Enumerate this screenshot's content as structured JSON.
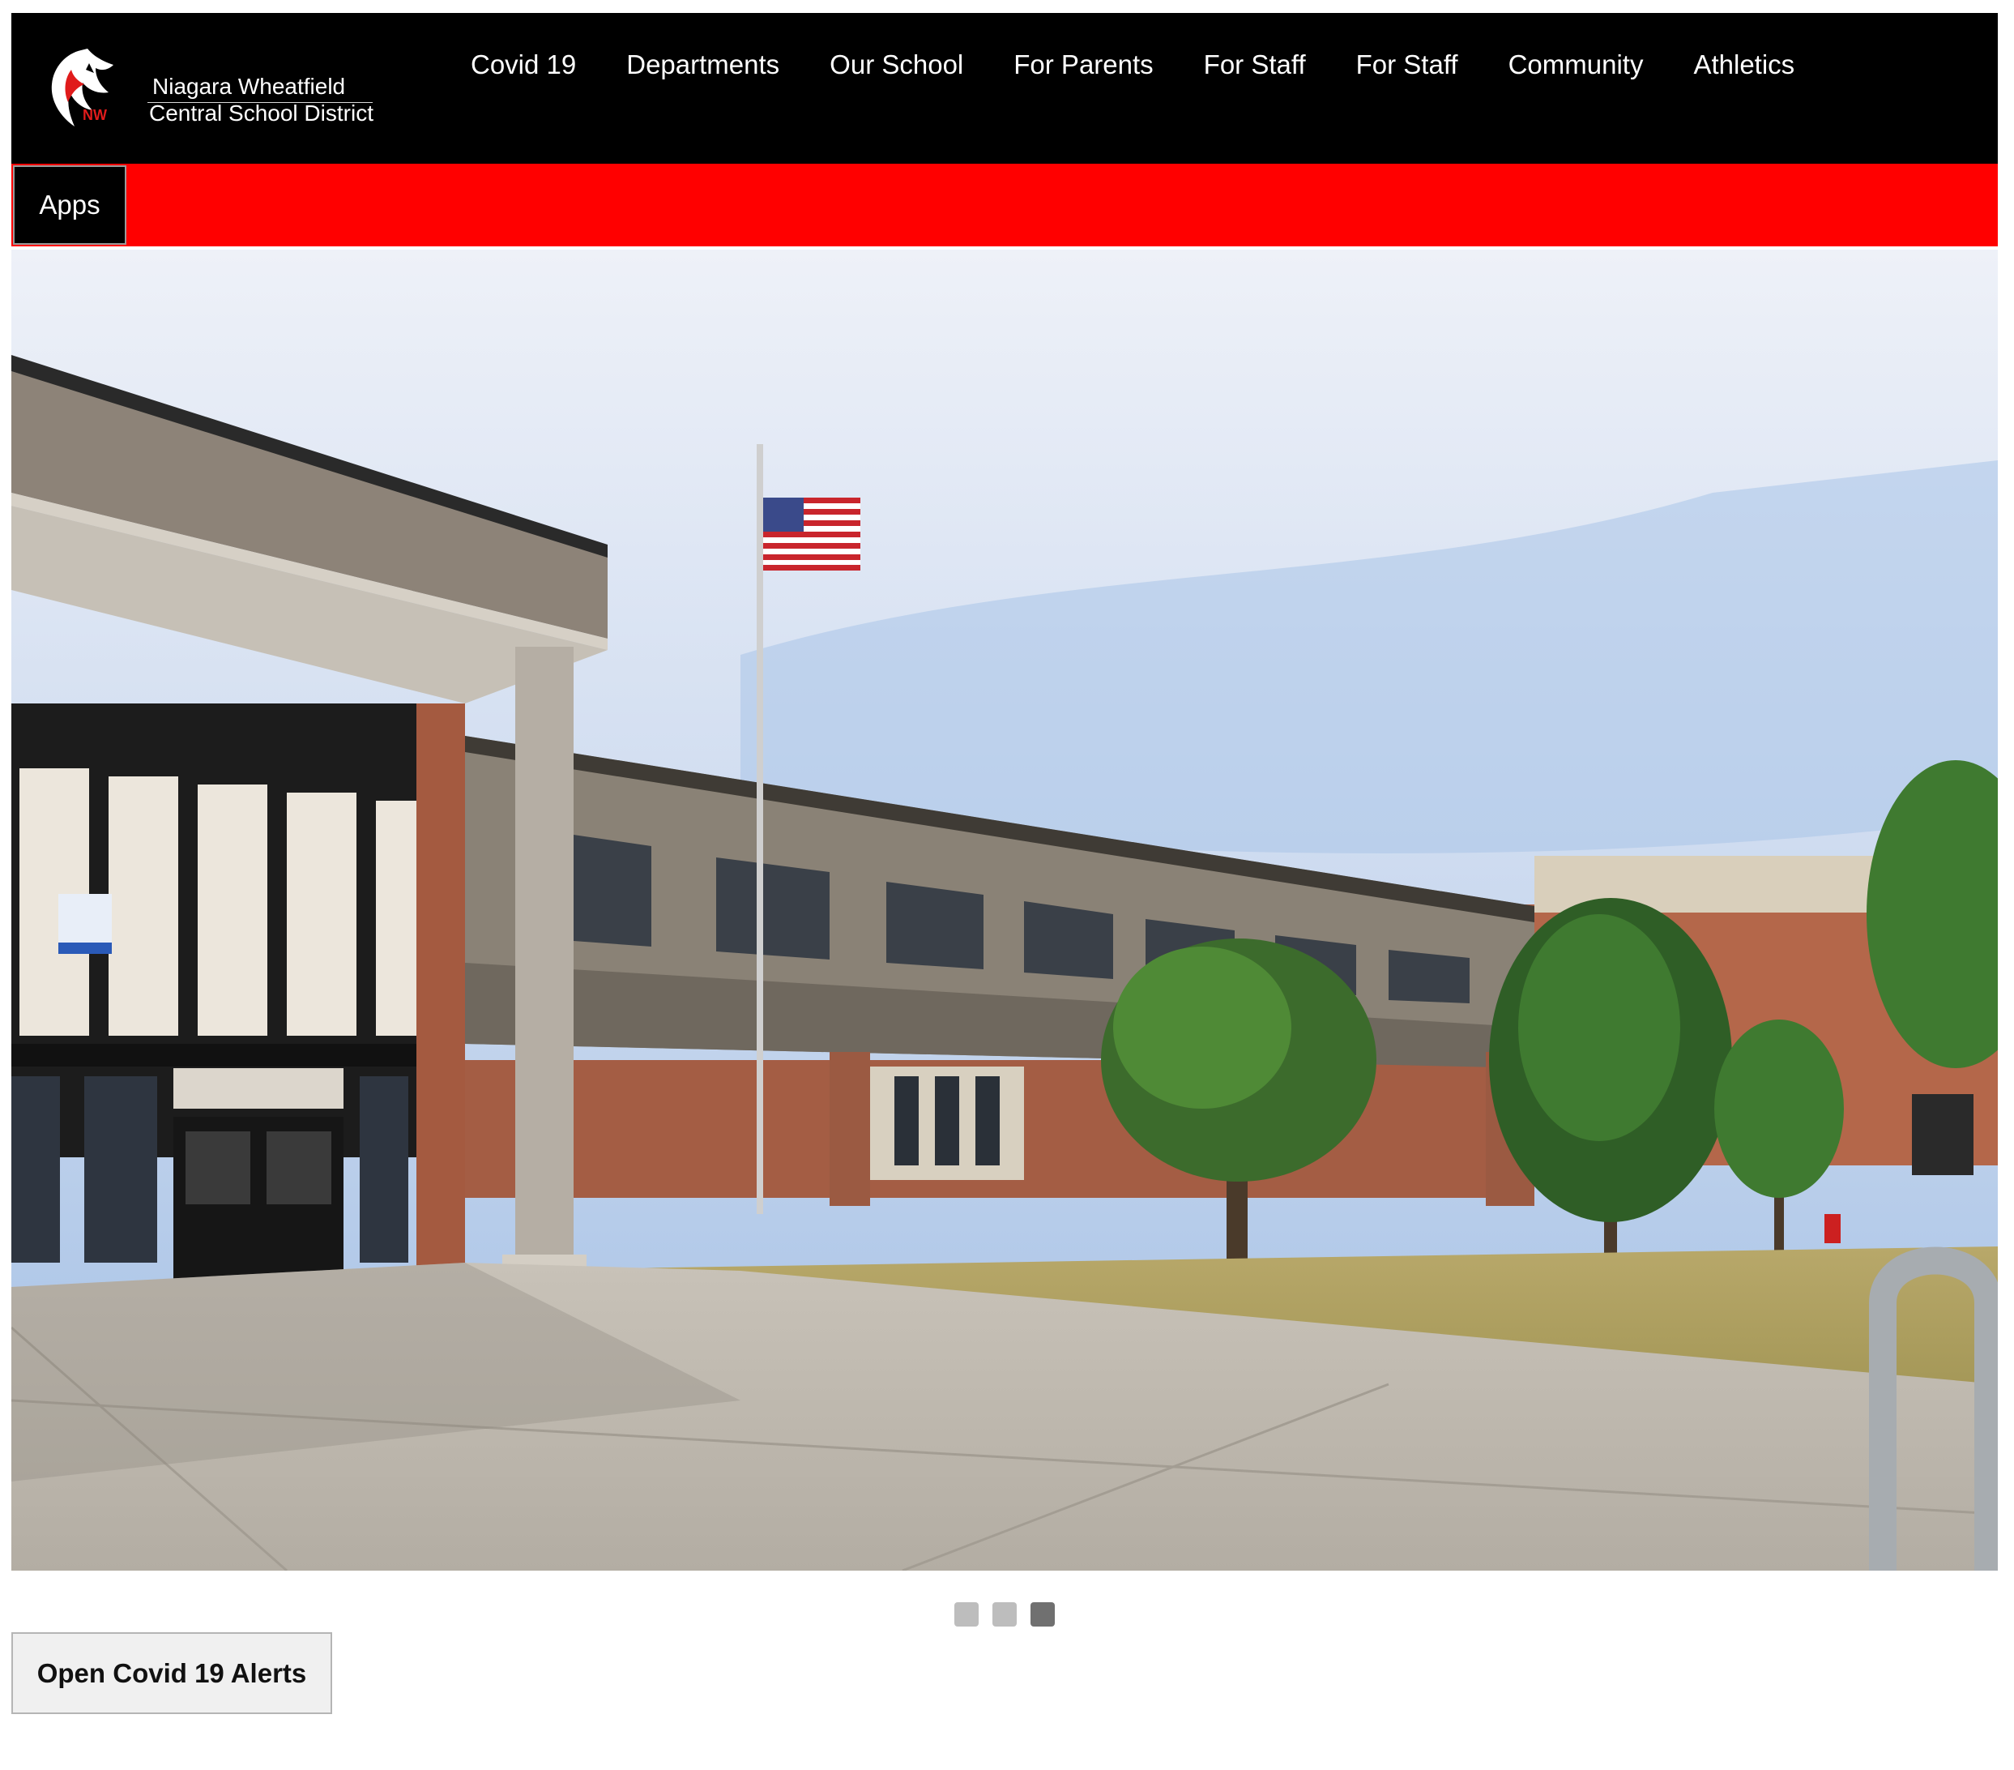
{
  "header": {
    "logo_line1": "Niagara Wheatfield",
    "logo_line2": "Central School District",
    "logo_monogram": "NW",
    "logo_icon": "wildcat-logo-icon"
  },
  "nav": {
    "items": [
      {
        "label": "Covid 19"
      },
      {
        "label": "Departments"
      },
      {
        "label": "Our School"
      },
      {
        "label": "For Parents"
      },
      {
        "label": "For Staff"
      },
      {
        "label": "For Staff"
      },
      {
        "label": "Community"
      },
      {
        "label": "Athletics"
      }
    ]
  },
  "apps": {
    "label": "Apps"
  },
  "carousel": {
    "slide_count": 3,
    "active_index": 2
  },
  "covid_button": {
    "label": "Open Covid 19 Alerts"
  },
  "colors": {
    "header_bg": "#000000",
    "accent_bar": "#ff0000",
    "text_light": "#ffffff"
  }
}
